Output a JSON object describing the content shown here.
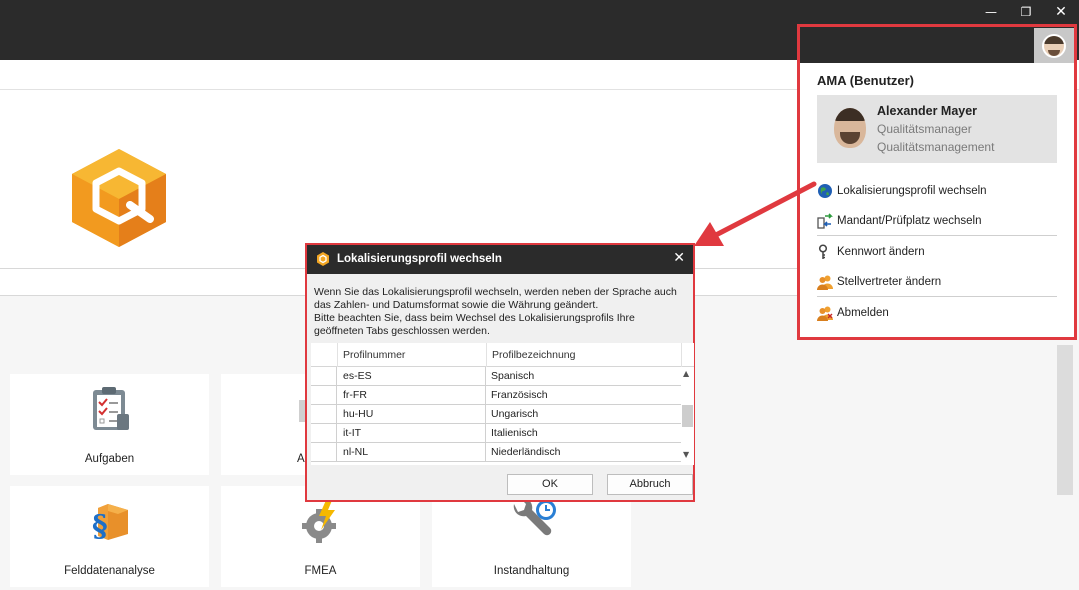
{
  "window": {
    "minimize_glyph": "—",
    "restore_glyph": "❐",
    "close_glyph": "✕"
  },
  "tiles": [
    {
      "label": "Aufgaben",
      "icon": "clipboard-checklist-icon"
    },
    {
      "label": "A",
      "icon": "document-icon"
    },
    {
      "label": "Felddatenanalyse",
      "icon": "paragraph-box-icon"
    },
    {
      "label": "FMEA",
      "icon": "gear-lightning-icon"
    },
    {
      "label": "Instandhaltung",
      "icon": "wrench-clock-icon"
    }
  ],
  "user_panel": {
    "title": "AMA (Benutzer)",
    "name": "Alexander Mayer",
    "role": "Qualitätsmanager",
    "department": "Qualitätsmanagement",
    "menu": [
      {
        "label": "Lokalisierungsprofil wechseln",
        "icon": "globe-icon"
      },
      {
        "label": "Mandant/Prüfplatz wechseln",
        "icon": "switch-arrows-icon"
      },
      {
        "label": "Kennwort ändern",
        "icon": "key-icon"
      },
      {
        "label": "Stellvertreter ändern",
        "icon": "users-icon"
      },
      {
        "label": "Abmelden",
        "icon": "logout-users-icon"
      }
    ]
  },
  "dialog": {
    "title": "Lokalisierungsprofil wechseln",
    "close_glyph": "✕",
    "message_line1": "Wenn Sie das Lokalisierungsprofil wechseln, werden neben der Sprache auch",
    "message_line2": "das Zahlen- und Datumsformat sowie die Währung geändert.",
    "message_line3": "Bitte beachten Sie, dass beim Wechsel des Lokalisierungsprofils Ihre",
    "message_line4": "geöffneten Tabs geschlossen werden.",
    "columns": [
      "Profilnummer",
      "Profilbezeichnung"
    ],
    "rows": [
      {
        "code": "es-ES",
        "name": "Spanisch"
      },
      {
        "code": "fr-FR",
        "name": "Französisch"
      },
      {
        "code": "hu-HU",
        "name": "Ungarisch"
      },
      {
        "code": "it-IT",
        "name": "Italienisch"
      },
      {
        "code": "nl-NL",
        "name": "Niederländisch"
      }
    ],
    "ok_label": "OK",
    "cancel_label": "Abbruch"
  },
  "colors": {
    "accent_red": "#e0393f",
    "logo_orange": "#f2a623",
    "topbar": "#2b2b2b"
  }
}
